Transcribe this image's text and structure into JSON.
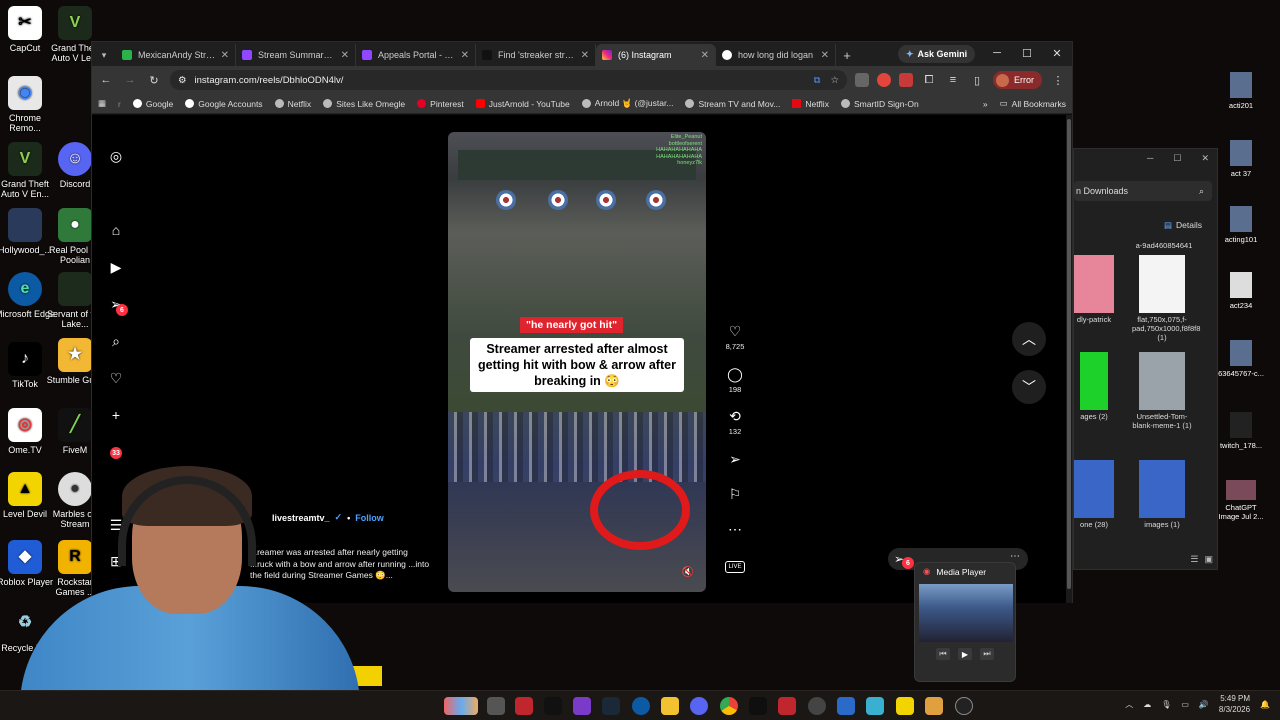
{
  "desktop_left": [
    {
      "label": "CapCut"
    },
    {
      "label": "Grand Theft Auto V Le..."
    },
    {
      "label": "Chrome Remo..."
    },
    {
      "label": "Grand Theft Auto V En..."
    },
    {
      "label": "Discord"
    },
    {
      "label": "Hollywood_..."
    },
    {
      "label": "Real Pool 3 - Poolian"
    },
    {
      "label": "Microsoft Edge"
    },
    {
      "label": "Servant of the Lake..."
    },
    {
      "label": "TikTok"
    },
    {
      "label": "Stumble Guys"
    },
    {
      "label": "Ome.TV"
    },
    {
      "label": "FiveM"
    },
    {
      "label": "Level Devil"
    },
    {
      "label": "Marbles on Stream"
    },
    {
      "label": "Roblox Player"
    },
    {
      "label": "Rockstar Games ..."
    },
    {
      "label": "Recycle Bin"
    }
  ],
  "browser": {
    "tabs": [
      {
        "label": "MexicanAndy Stream"
      },
      {
        "label": "Stream Summary - T"
      },
      {
        "label": "Appeals Portal - Twi"
      },
      {
        "label": "Find 'streaker stream"
      },
      {
        "label": "(6) Instagram"
      },
      {
        "label": "how long did logan"
      }
    ],
    "gemini_label": "Ask Gemini",
    "url": "instagram.com/reels/DbhloODN4lv/",
    "error_label": "Error",
    "bookmarks": [
      {
        "label": "Google"
      },
      {
        "label": "Google Accounts"
      },
      {
        "label": "Netflix"
      },
      {
        "label": "Sites Like Omegle"
      },
      {
        "label": "Pinterest"
      },
      {
        "label": "JustArnold - YouTube"
      },
      {
        "label": "Arnold 🤘 (@justar..."
      },
      {
        "label": "Stream TV and Mov..."
      },
      {
        "label": "Netflix"
      },
      {
        "label": "SmartID Sign-On"
      }
    ],
    "all_bookmarks": "All Bookmarks"
  },
  "instagram": {
    "notif_count": "6",
    "msg_count": "33",
    "video": {
      "chat_lines": [
        "Elite_Peanut",
        "bottleofserent",
        "HAHAHAHAHAHA",
        "HAHAHAHAHAHA",
        "honeyz7lk"
      ],
      "tag": "\"he nearly got hit\"",
      "caption": "Streamer arrested after almost getting hit with bow & arrow after breaking in 😳"
    },
    "likes": "8,725",
    "comments": "198",
    "reposts": "132",
    "live_label": "LIVE",
    "poster": "livestreamtv_",
    "follow_label": "Follow",
    "description": "...reamer was arrested after nearly getting ...ruck with a bow and arrow after running ...into the field during Streamer Games 😳..."
  },
  "explorer": {
    "search": "n Downloads",
    "details_label": "Details",
    "items": [
      {
        "label": "a-9ad460854641"
      },
      {
        "label": "dly-patrick"
      },
      {
        "label": "flat,750x,075,f-pad,750x1000,f8f8f8 (1)"
      },
      {
        "label": "ages (2)"
      },
      {
        "label": "Unsettled-Tom-blank-meme-1 (1)"
      },
      {
        "label": "one (28)"
      },
      {
        "label": "images (1)"
      }
    ]
  },
  "desktop_right": [
    {
      "label": "acti201"
    },
    {
      "label": "act 37"
    },
    {
      "label": "acting101"
    },
    {
      "label": "act234"
    },
    {
      "label": "63645767-c..."
    },
    {
      "label": "twitch_178..."
    },
    {
      "label": "ChatGPT Image Jul 2..."
    }
  ],
  "media_player": {
    "title": "Media Player"
  },
  "clock": {
    "time": "5:49 PM",
    "date": "8/3/2026"
  }
}
